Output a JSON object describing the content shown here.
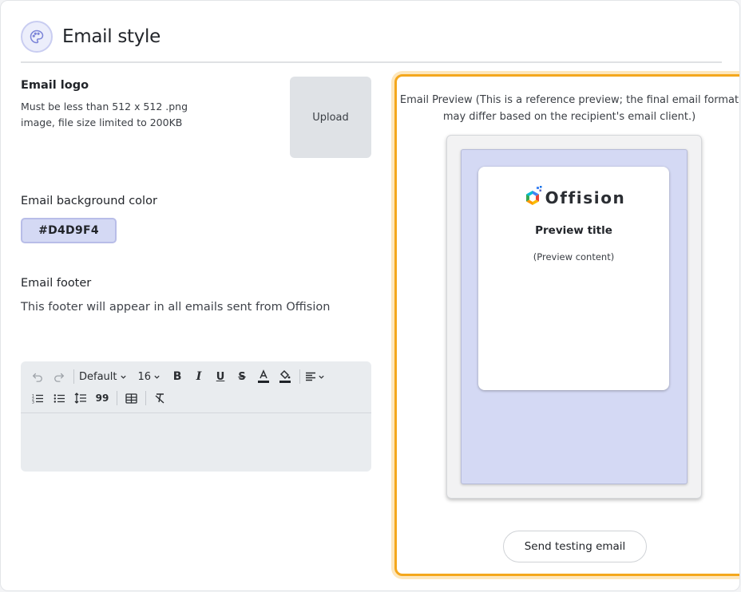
{
  "header": {
    "title": "Email style",
    "icon": "palette-icon"
  },
  "logo": {
    "label": "Email logo",
    "description": "Must be less than 512 x 512 .png image, file size limited to 200KB",
    "upload_label": "Upload"
  },
  "background": {
    "label": "Email background color",
    "value": "#D4D9F4"
  },
  "footer": {
    "label": "Email footer",
    "description": "This footer will appear in all emails sent from Offision"
  },
  "editor": {
    "font_family": "Default",
    "font_size": "16",
    "tools_row1": [
      "undo-icon",
      "redo-icon",
      "bold-icon",
      "italic-icon",
      "underline-icon",
      "strikethrough-icon",
      "font-color-icon",
      "highlight-icon",
      "align-icon"
    ],
    "tools_row2": [
      "ordered-list-icon",
      "bullet-list-icon",
      "line-height-icon",
      "quote-icon",
      "table-icon",
      "clear-format-icon"
    ],
    "content": ""
  },
  "preview": {
    "note": "Email Preview (This is a reference preview; the final email format may differ based on the recipient's email client.)",
    "brand": "Offision",
    "title": "Preview title",
    "content": "(Preview content)",
    "send_label": "Send testing email"
  },
  "colors": {
    "accent_border": "#f4a71d",
    "email_background": "#D4D9F4",
    "header_icon_bg": "#eceefb"
  }
}
